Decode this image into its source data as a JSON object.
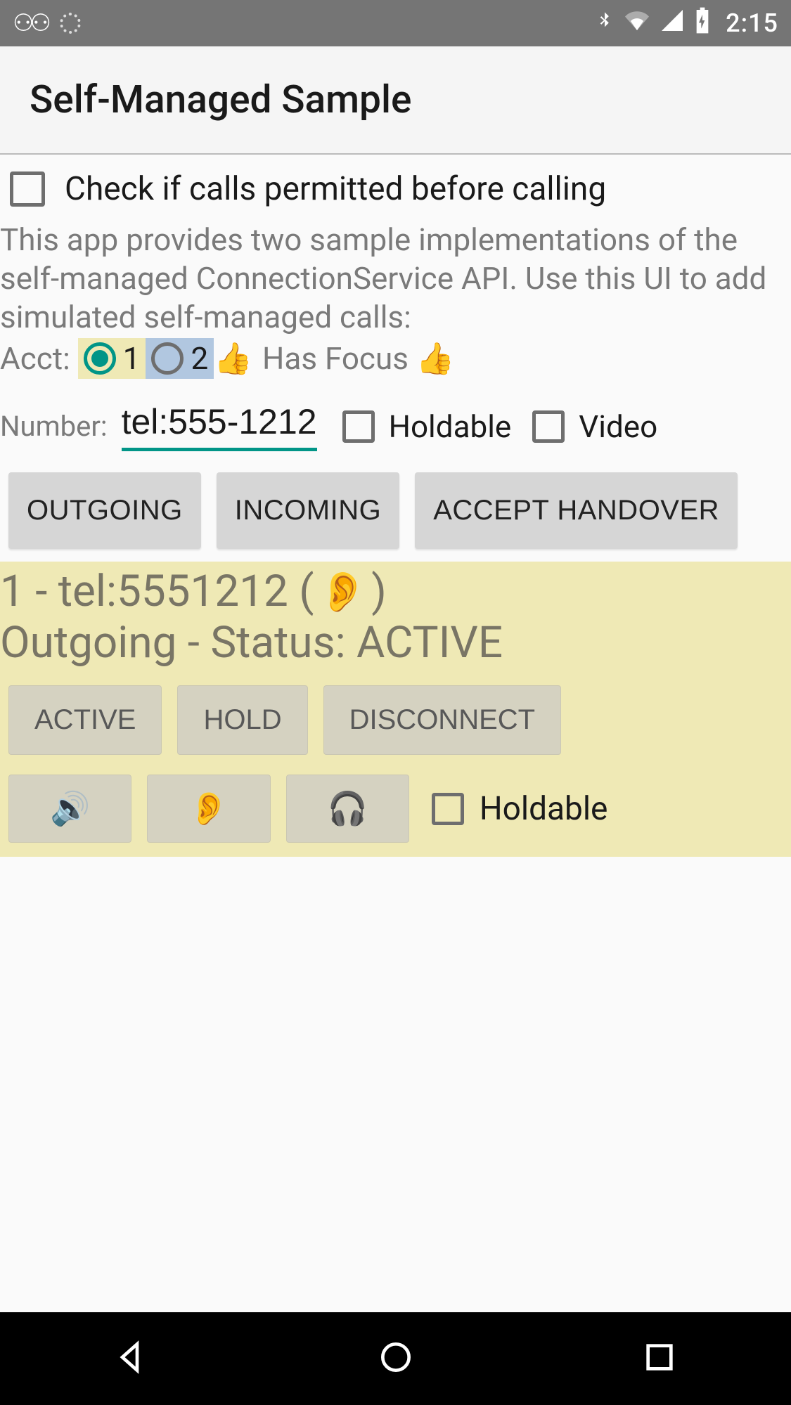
{
  "status_bar": {
    "time": "2:15"
  },
  "app": {
    "title": "Self-Managed Sample"
  },
  "permit_checkbox": {
    "label": "Check if calls permitted before calling",
    "checked": false
  },
  "description": "This app provides two sample implementations of the self-managed ConnectionService API.  Use this UI to add simulated self-managed calls:",
  "acct": {
    "label": "Acct:",
    "options": [
      {
        "value": "1",
        "selected": true
      },
      {
        "value": "2",
        "selected": false
      }
    ],
    "focus_prefix_emoji": "👍",
    "focus_text": "Has Focus",
    "focus_suffix_emoji": "👍"
  },
  "number": {
    "label": "Number:",
    "value": "tel:555-1212",
    "holdable": {
      "label": "Holdable",
      "checked": false
    },
    "video": {
      "label": "Video",
      "checked": false
    }
  },
  "buttons": {
    "outgoing": "OUTGOING",
    "incoming": "INCOMING",
    "accept_handover": "ACCEPT HANDOVER"
  },
  "call": {
    "line1_prefix": "1 - tel:5551212 (",
    "line1_emoji": "👂",
    "line1_suffix": ")",
    "line2": "Outgoing - Status: ACTIVE",
    "buttons": {
      "active": "ACTIVE",
      "hold": "HOLD",
      "disconnect": "DISCONNECT"
    },
    "audio": {
      "speaker": "🔊",
      "earpiece": "👂",
      "headset": "🎧"
    },
    "holdable": {
      "label": "Holdable",
      "checked": false
    }
  }
}
